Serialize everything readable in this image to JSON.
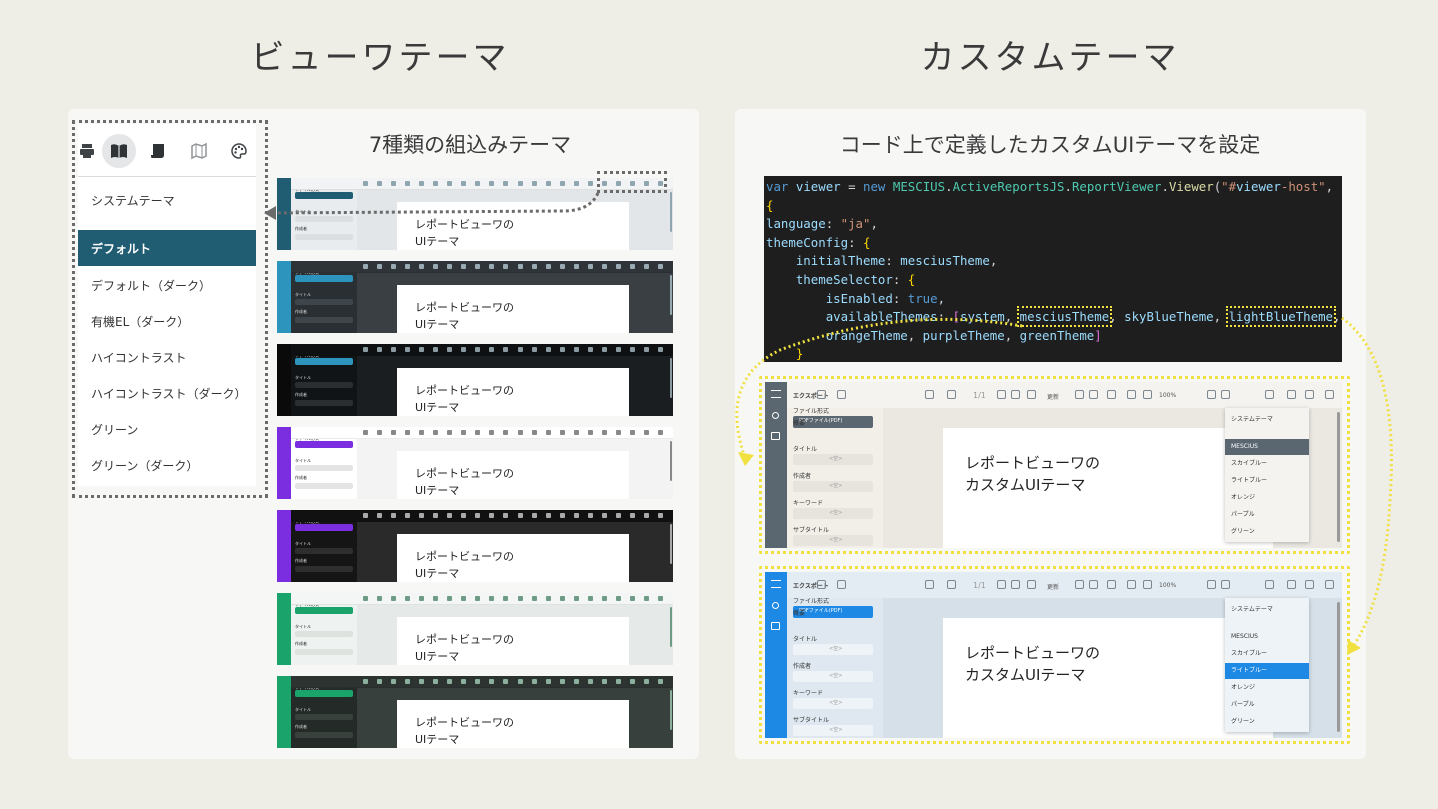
{
  "left": {
    "title": "ビューワテーマ",
    "subtitle": "7種類の組込みテーマ"
  },
  "right": {
    "title": "カスタムテーマ",
    "subtitle": "コード上で定義したカスタムUIテーマを設定"
  },
  "theme_menu": {
    "icons": [
      "print-icon",
      "book-icon",
      "scroll-icon",
      "map-icon",
      "palette-icon"
    ],
    "items": [
      "システムテーマ",
      "デフォルト",
      "デフォルト（ダーク）",
      "有機EL（ダーク）",
      "ハイコントラスト",
      "ハイコントラスト（ダーク）",
      "グリーン",
      "グリーン（ダーク）"
    ],
    "selected_index": 1
  },
  "thumbnail": {
    "page_text_1": "レポートビューワの",
    "page_text_2": "UIテーマ",
    "export_label": "エクスポート",
    "format_label": "ファイル形式",
    "format_value": "PDFファイル(PDF)",
    "summary_label": "概要",
    "title_label": "タイトル",
    "author_label": "作成者",
    "themes": [
      {
        "rail": "#205d72",
        "side": "#e8ecee",
        "tb": "#f1f3f4",
        "area": "#e3e6e8",
        "sel": "#205d72",
        "fld": "#dcdfe1",
        "text": "#222",
        "icon": "#8fa6b0"
      },
      {
        "rail": "#2c94bd",
        "side": "#2a2f33",
        "tb": "#2f3438",
        "area": "#3a3f43",
        "sel": "#2c94bd",
        "fld": "#3f464b",
        "text": "#ddd",
        "icon": "#9aaab3"
      },
      {
        "rail": "#0a0a0a",
        "side": "#111416",
        "tb": "#0e1012",
        "area": "#1b1e20",
        "sel": "#2c94bd",
        "fld": "#2a2e31",
        "text": "#ddd",
        "icon": "#8c9aa2"
      },
      {
        "rail": "#7b2ee0",
        "side": "#ffffff",
        "tb": "#ffffff",
        "area": "#f3f3f3",
        "sel": "#7b2ee0",
        "fld": "#e4e4e4",
        "text": "#222",
        "icon": "#888888"
      },
      {
        "rail": "#7b2ee0",
        "side": "#151515",
        "tb": "#111111",
        "area": "#2a2a2a",
        "sel": "#7b2ee0",
        "fld": "#2e2e2e",
        "text": "#ddd",
        "icon": "#aaaaaa"
      },
      {
        "rail": "#1aa36a",
        "side": "#eef2f0",
        "tb": "#f3f6f4",
        "area": "#e5e9e7",
        "sel": "#1aa36a",
        "fld": "#dde2df",
        "text": "#222",
        "icon": "#6e9b86"
      },
      {
        "rail": "#1aa36a",
        "side": "#242a27",
        "tb": "#2c3330",
        "area": "#37403c",
        "sel": "#1aa36a",
        "fld": "#39413d",
        "text": "#ddd",
        "icon": "#8bb09e"
      }
    ]
  },
  "code_lines": [
    "var viewer = new MESCIUS.ActiveReportsJS.ReportViewer.Viewer(\"#viewer-host\",",
    "{",
    "language: \"ja\",",
    "themeConfig: {",
    "    initialTheme: mesciusTheme,",
    "    themeSelector: {",
    "        isEnabled: true,",
    "        availableThemes: [system, mesciusTheme, skyBlueTheme, lightBlueTheme,",
    "        orangeTheme, purpleTheme, greenTheme]",
    "    }"
  ],
  "big_viewer": {
    "page_text_1": "レポートビューワの",
    "page_text_2": "カスタムUIテーマ",
    "export_label": "エクスポート",
    "format_label": "ファイル形式",
    "format_value": "PDFファイル(PDF)",
    "summary_label": "概要",
    "title_label": "タイトル",
    "author_label": "作成者",
    "keyword_label": "キーワード",
    "subtitle_label": "サブタイトル",
    "field_placeholder": "<空>",
    "refresh_label": "更新",
    "zoom_label": "100%",
    "page_label": "1/1",
    "dropdown_items": [
      "システムテーマ",
      "MESCIUS",
      "スカイブルー",
      "ライトブルー",
      "オレンジ",
      "パープル",
      "グリーン"
    ],
    "themes": [
      {
        "rail": "#5b6770",
        "side": "#f2efe9",
        "tb": "#f5f3ef",
        "area": "#ebe8e2",
        "sel": "#5b6770",
        "fld": "#e7e4de",
        "dd_bg": "#f5f3ef",
        "dd_sel": "#5b6770",
        "sel_index": 1
      },
      {
        "rail": "#1e88e5",
        "side": "#dfe8f0",
        "tb": "#e4ecf3",
        "area": "#d6e0e9",
        "sel": "#1e88e5",
        "fld": "#eef3f7",
        "dd_bg": "#eef3f7",
        "dd_sel": "#1e88e5",
        "sel_index": 3
      }
    ]
  }
}
